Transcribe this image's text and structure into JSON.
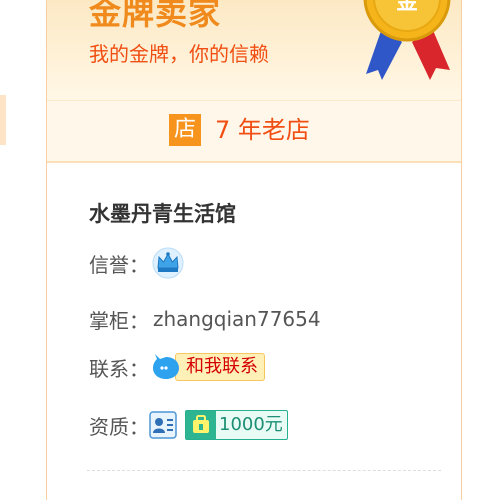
{
  "banner": {
    "title": "金牌卖家",
    "slogan": "我的金牌，你的信赖",
    "medal_text": "金",
    "colors": {
      "title": "#f08a1c",
      "slogan": "#f04e12",
      "medal_gold": "#f5b41a",
      "ribbon_blue": "#2f57c8",
      "ribbon_red": "#d9262c"
    }
  },
  "store_age": {
    "icon_text": "店",
    "text": "7 年老店"
  },
  "shop": {
    "name": "水墨丹青生活馆",
    "reputation_label": "信誉：",
    "reputation_icon": "blue-crown-icon",
    "keeper_label": "掌柜：",
    "keeper_value": "zhangqian77654",
    "contact_label": "联系：",
    "contact_button": "和我联系",
    "contact_icon": "chat-bubble-icon",
    "credentials_label": "资质：",
    "credentials_id_icon": "id-card-icon",
    "deposit_icon": "deposit-bag-icon",
    "deposit_value": "1000元"
  }
}
